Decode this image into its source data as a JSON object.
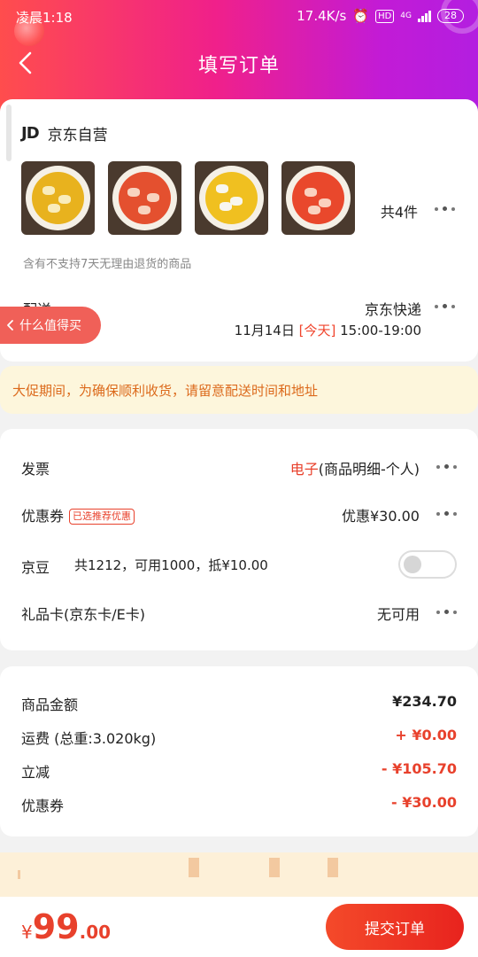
{
  "status_bar": {
    "time": "凌晨1:18",
    "speed": "17.4K/s",
    "hd": "HD",
    "network": "4G",
    "battery": "28"
  },
  "header": {
    "title": "填写订单"
  },
  "shop": {
    "logo": "JD",
    "name": "京东自营",
    "item_count": "共4件",
    "return_note": "含有不支持7天无理由退货的商品",
    "items": [
      {
        "name": "dish-1",
        "color": "#e8b21e"
      },
      {
        "name": "dish-2",
        "color": "#e4502f"
      },
      {
        "name": "dish-3",
        "color": "#f0c020"
      },
      {
        "name": "dish-4",
        "color": "#e9482c"
      }
    ]
  },
  "delivery": {
    "label": "配送",
    "carrier": "京东快递",
    "date": "11月14日",
    "today": "[今天]",
    "window": "15:00-19:00"
  },
  "float_tag": {
    "label": "什么值得买"
  },
  "notice": {
    "text": "大促期间，为确保顺利收货，请留意配送时间和地址"
  },
  "options": {
    "invoice": {
      "label": "发票",
      "type": "电子",
      "detail": "(商品明细-个人)"
    },
    "coupon": {
      "label": "优惠券",
      "tag": "已选推荐优惠",
      "value": "优惠¥30.00"
    },
    "beans": {
      "label": "京豆",
      "text": "共1212，可用1000，抵¥10.00",
      "enabled": false
    },
    "gift_card": {
      "label": "礼品卡(京东卡/E卡)",
      "value": "无可用"
    }
  },
  "summary": {
    "goods_label": "商品金额",
    "goods_value": "¥234.70",
    "shipping_label": "运费 (总重:3.020kg)",
    "shipping_value": "+ ¥0.00",
    "discount_label": "立减",
    "discount_value": "- ¥105.70",
    "coupon_label": "优惠券",
    "coupon_value": "- ¥30.00"
  },
  "footer": {
    "currency": "¥",
    "price_int": "99",
    "price_dec": ".00",
    "submit_label": "提交订单"
  }
}
